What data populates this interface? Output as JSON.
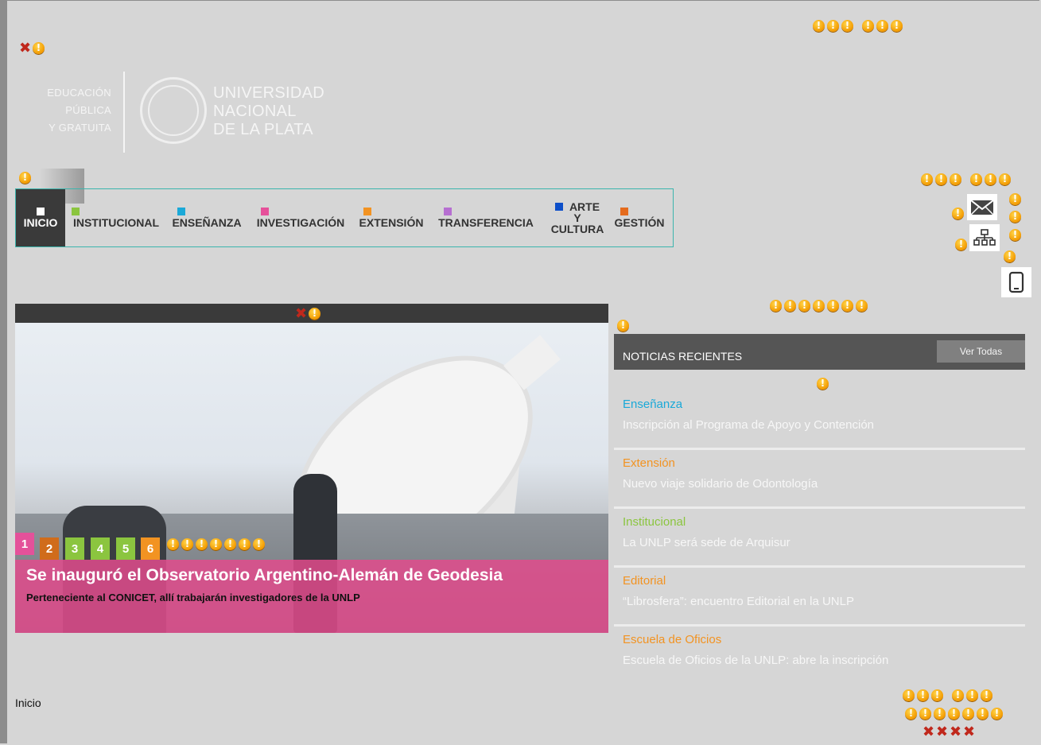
{
  "logo": {
    "left_lines": [
      "EDUCACIÓN",
      "PÚBLICA",
      "Y GRATUITA"
    ],
    "right_lines": [
      "UNIVERSIDAD",
      "NACIONAL",
      "DE LA PLATA"
    ]
  },
  "nav": {
    "items": [
      {
        "label": "INICIO",
        "color": "#ffffff",
        "active": true
      },
      {
        "label": "INSTITUCIONAL",
        "color": "#8bc53f"
      },
      {
        "label": "ENSEÑANZA",
        "color": "#1ba9d8"
      },
      {
        "label": "INVESTIGACIÓN",
        "color": "#e6509a"
      },
      {
        "label": "EXTENSIÓN",
        "color": "#f29322"
      },
      {
        "label": "TRANSFERENCIA",
        "color": "#b66fd1"
      },
      {
        "label_lines": [
          "ARTE",
          "Y",
          "CULTURA"
        ],
        "color": "#0d4fc9"
      },
      {
        "label": "GESTIÓN",
        "color": "#e46b1d"
      }
    ]
  },
  "slider": {
    "numbers": [
      {
        "n": "1",
        "color": "#e4519a"
      },
      {
        "n": "2",
        "color": "#d06c1b"
      },
      {
        "n": "3",
        "color": "#8bc53f"
      },
      {
        "n": "4",
        "color": "#8bc53f"
      },
      {
        "n": "5",
        "color": "#8bc53f"
      },
      {
        "n": "6",
        "color": "#f29322"
      }
    ],
    "title": "Se inauguró el Observatorio Argentino-Alemán de Geodesia",
    "subtitle": "Perteneciente al CONICET, allí trabajarán investigadores de la UNLP"
  },
  "news": {
    "heading": "NOTICIAS RECIENTES",
    "ver_todas": "Ver Todas",
    "items": [
      {
        "category": "Enseñanza",
        "color": "#1ba9d8",
        "title": "Inscripción al Programa de Apoyo y Contención"
      },
      {
        "category": "Extensión",
        "color": "#f29322",
        "title": "Nuevo viaje solidario de Odontología"
      },
      {
        "category": "Institucional",
        "color": "#8bc53f",
        "title": "La UNLP será sede de Arquisur"
      },
      {
        "category": "Editorial",
        "color": "#f29322",
        "title": "“Librosfera”: encuentro Editorial en la UNLP"
      },
      {
        "category": "Escuela de Oficios",
        "color": "#f29322",
        "title": "Escuela de Oficios de la UNLP: abre la inscripción"
      }
    ]
  },
  "footer": {
    "breadcrumb": "Inicio"
  },
  "icons": {
    "mail": "mail-icon",
    "sitemap": "sitemap-icon",
    "tablet": "tablet-icon"
  }
}
